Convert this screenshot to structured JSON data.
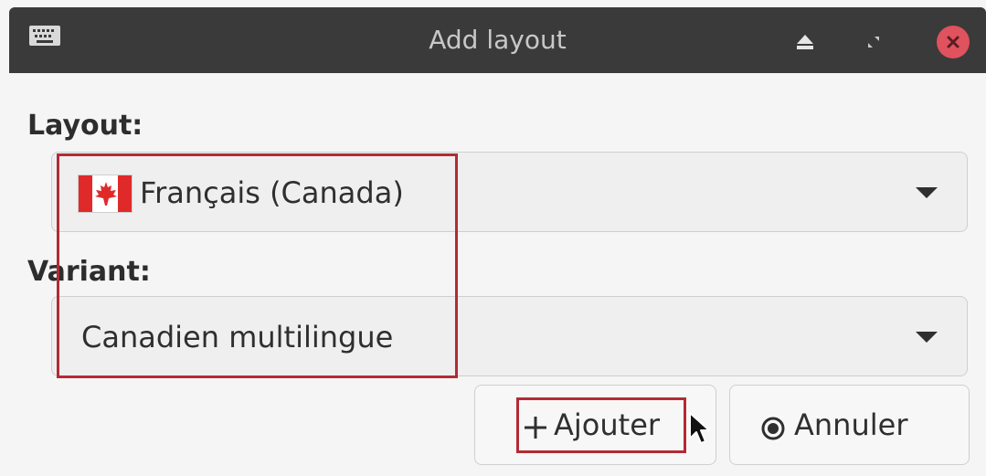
{
  "window": {
    "title": "Add layout",
    "icons": {
      "app": "keyboard-icon",
      "eject": "eject-icon",
      "restore": "restore-icon",
      "close": "close-icon"
    },
    "colors": {
      "titlebar": "#3a3a3a",
      "close_button": "#e0525d",
      "annotation": "#b22b35"
    }
  },
  "form": {
    "layout_label": "Layout:",
    "layout_value": "Français (Canada)",
    "layout_flag": "canada-flag-icon",
    "variant_label": "Variant:",
    "variant_value": "Canadien multilingue"
  },
  "buttons": {
    "add_label": "Ajouter",
    "cancel_label": "Annuler"
  }
}
